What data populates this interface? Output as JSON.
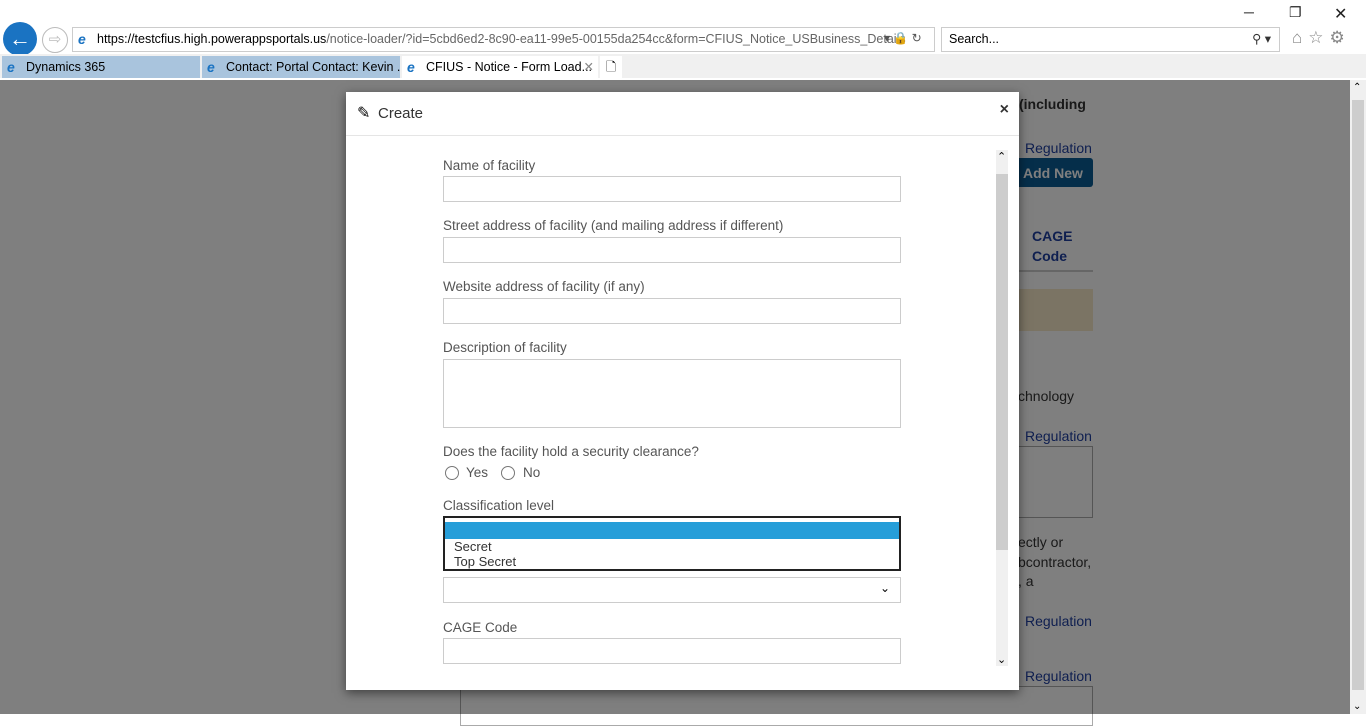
{
  "browser": {
    "url_host_pre": "https://testcfius.high.",
    "url_host": "powerappsportals.us",
    "url_path": "/notice-loader/?id=5cbd6ed2-8c90-ea11-99e5-00155da254cc&form=CFIUS_Notice_USBusiness_Details",
    "search_placeholder": "Search...",
    "tabs": [
      {
        "label": "Dynamics 365"
      },
      {
        "label": "Contact: Portal Contact: Kevin ..."
      },
      {
        "label": "CFIUS - Notice - Form Load..."
      }
    ]
  },
  "background": {
    "heading_fragment": "(including",
    "regulation_link": "Regulation",
    "add_new": "Add New",
    "cage_code_header_1": "CAGE",
    "cage_code_header_2": "Code",
    "text1": "chnology",
    "text2": "ectly or",
    "text3": "bcontractor,",
    "text4": ", a"
  },
  "modal": {
    "title": "Create",
    "fields": {
      "name": "Name of facility",
      "street": "Street address of facility (and mailing address if different)",
      "website": "Website address of facility (if any)",
      "description": "Description of facility",
      "clearance": "Does the facility hold a security clearance?",
      "yes": "Yes",
      "no": "No",
      "classification": "Classification level",
      "cage": "CAGE Code"
    },
    "classification_options": [
      "",
      "Secret",
      "Top Secret"
    ]
  }
}
